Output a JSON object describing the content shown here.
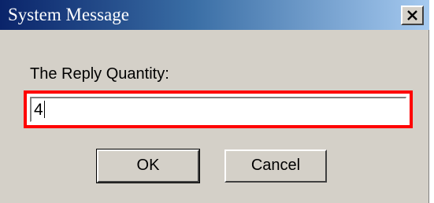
{
  "dialog": {
    "title": "System Message",
    "close_icon": "close-x-icon",
    "prompt_label": "The Reply Quantity:",
    "input_value": "4",
    "highlight_color": "#ff0000",
    "buttons": {
      "ok_label": "OK",
      "cancel_label": "Cancel"
    }
  }
}
